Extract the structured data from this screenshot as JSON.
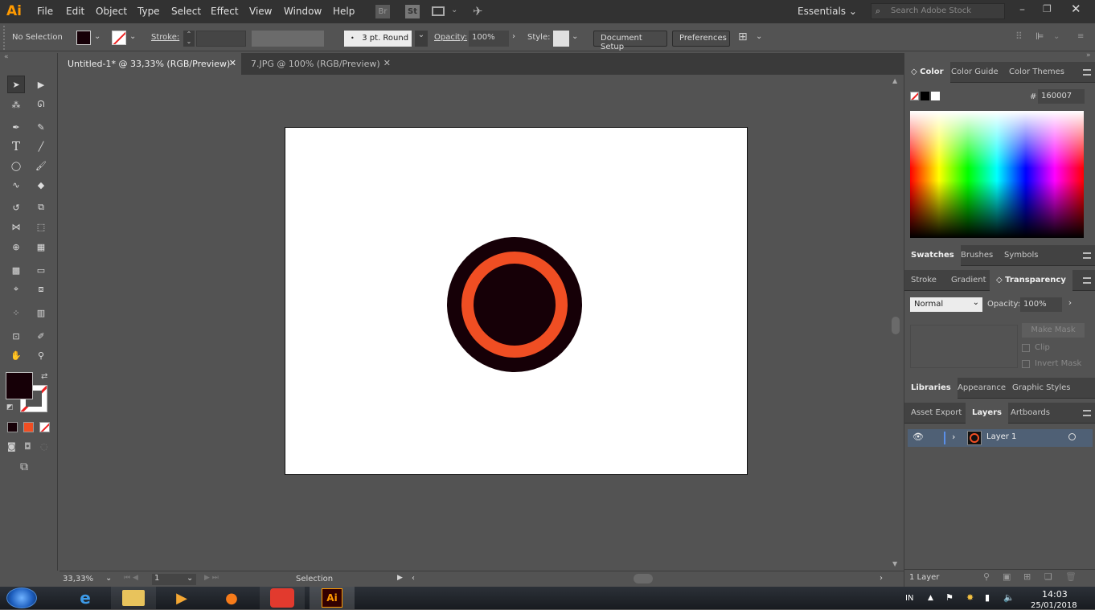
{
  "app": {
    "logo": "Ai",
    "workspace": "Essentials",
    "search_placeholder": "Search Adobe Stock",
    "bridge": "Br",
    "stock": "St"
  },
  "menu": [
    "File",
    "Edit",
    "Object",
    "Type",
    "Select",
    "Effect",
    "View",
    "Window",
    "Help"
  ],
  "control": {
    "selection": "No Selection",
    "stroke_label": "Stroke:",
    "brush": "3 pt. Round",
    "opacity_label": "Opacity:",
    "opacity": "100%",
    "style_label": "Style:",
    "doc_setup": "Document Setup",
    "preferences": "Preferences",
    "fill_color": "#160007"
  },
  "tabs": [
    {
      "label": "Untitled-1* @ 33,33% (RGB/Preview)",
      "active": true
    },
    {
      "label": "7.JPG @ 100% (RGB/Preview)",
      "active": false
    }
  ],
  "artwork": {
    "outer_color": "#160007",
    "ring_color": "#f04e23",
    "inner_color": "#160007"
  },
  "status": {
    "zoom": "33,33%",
    "artboard": "1",
    "tool": "Selection"
  },
  "color_panel": {
    "tabs": [
      "Color",
      "Color Guide",
      "Color Themes"
    ],
    "hex_label": "#",
    "hex": "160007"
  },
  "swatches_panel": {
    "tabs": [
      "Swatches",
      "Brushes",
      "Symbols"
    ]
  },
  "transparency_panel": {
    "tabs": [
      "Stroke",
      "Gradient",
      "Transparency"
    ],
    "blend": "Normal",
    "opacity_label": "Opacity:",
    "opacity": "100%",
    "make_mask": "Make Mask",
    "clip": "Clip",
    "invert_mask": "Invert Mask"
  },
  "libraries_panel": {
    "tabs": [
      "Libraries",
      "Appearance",
      "Graphic Styles"
    ]
  },
  "layers_panel": {
    "tabs": [
      "Asset Export",
      "Layers",
      "Artboards"
    ],
    "layer": "Layer 1",
    "count": "1 Layer"
  },
  "taskbar": {
    "lang": "IN",
    "time": "14:03",
    "date": "25/01/2018"
  }
}
